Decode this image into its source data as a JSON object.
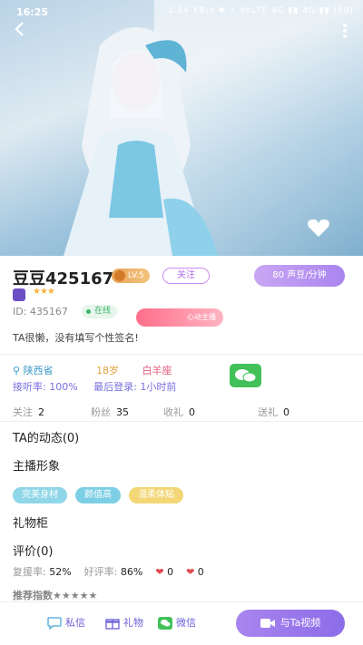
{
  "status_bar": {
    "time": "16:25",
    "indicators": "1.34 KB/s  ✱  ⚡  VoLTE  4G  ▮▮  4G  ▮▮  (59)"
  },
  "profile": {
    "name": "豆豆425167",
    "level": "LV.5",
    "follow_label": "关注",
    "price": "80 声豆/分钟",
    "stars": "★★★",
    "id_text": "ID: 435167",
    "online": "在线",
    "heart_pill": "心动主播",
    "signature": "TA很懒，没有填写个性签名!"
  },
  "info": {
    "location": "陕西省",
    "age": "18岁",
    "zodiac": "白羊座",
    "answer_rate": "接听率: 100%",
    "last_login": "最后登录: 1小时前"
  },
  "stats": [
    {
      "label": "关注",
      "value": "2"
    },
    {
      "label": "粉丝",
      "value": "35"
    },
    {
      "label": "收礼",
      "value": "0"
    },
    {
      "label": "送礼",
      "value": "0"
    }
  ],
  "sections": {
    "dynamics": "TA的动态(0)",
    "image": "主播形象",
    "gifts": "礼物柜",
    "reviews": "评价(0)"
  },
  "tags": [
    "完美身材",
    "颜值高",
    "温柔体贴"
  ],
  "rating": {
    "reply_label": "复援率:",
    "reply_value": "52%",
    "good_label": "好评率:",
    "good_value": "86%",
    "hearts1": "0",
    "hearts2": "0"
  },
  "peek_text": "推荐指数★★★★★",
  "bottom_bar": {
    "message": "私信",
    "gift": "礼物",
    "wechat": "微信",
    "video": "与Ta视频"
  },
  "colors": {
    "accent": "#a985ef",
    "wechat": "#41c158",
    "heart": "#e04a52"
  }
}
